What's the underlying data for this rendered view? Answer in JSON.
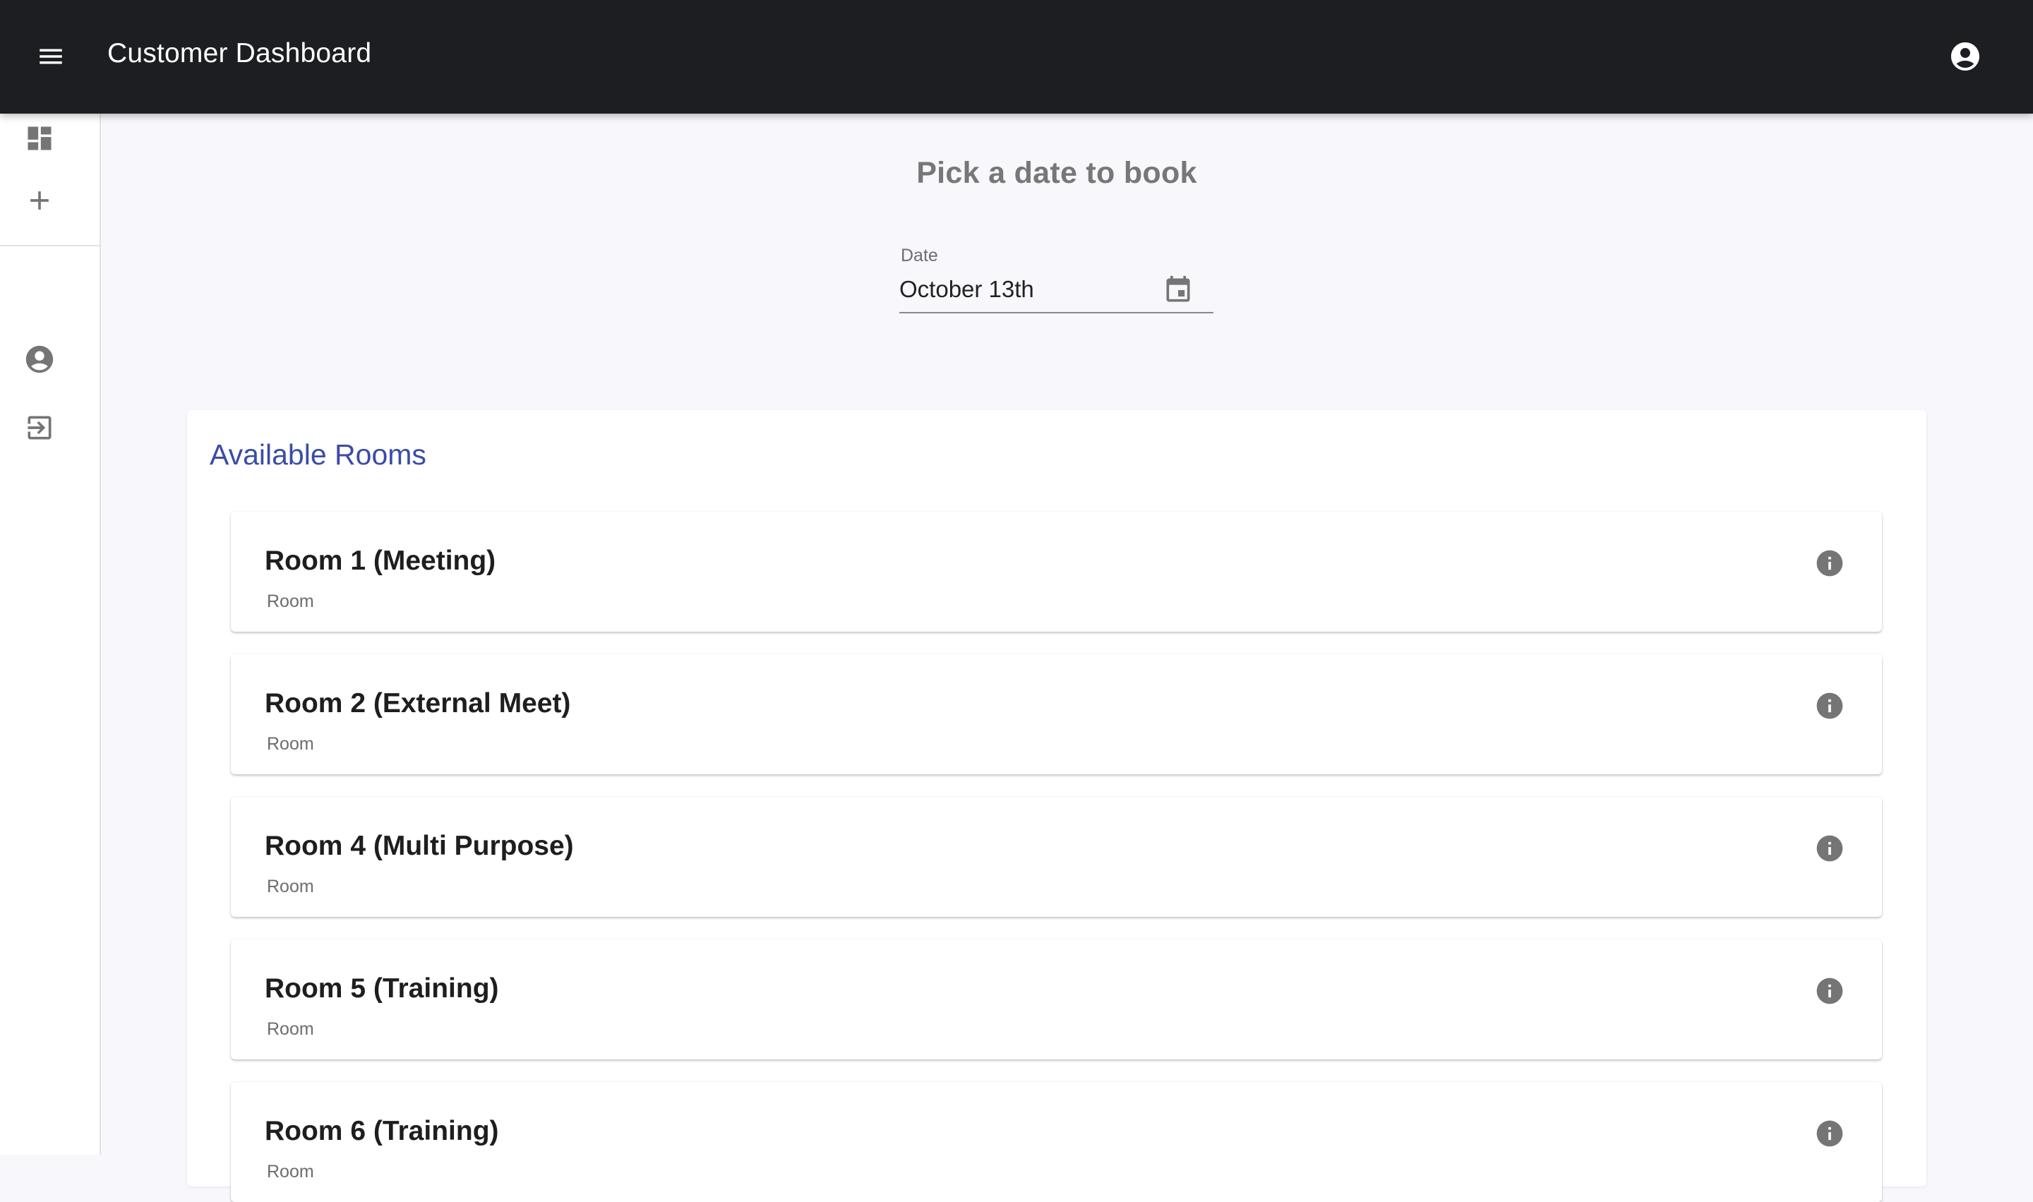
{
  "appbar": {
    "title": "Customer Dashboard",
    "menu_icon": "menu-icon",
    "account_icon": "account-circle-icon"
  },
  "sidebar": {
    "items": [
      {
        "icon": "dashboard-icon"
      },
      {
        "icon": "plus-icon"
      },
      {
        "icon": "account-circle-icon"
      },
      {
        "icon": "login-icon"
      }
    ]
  },
  "main": {
    "heading": "Pick a date to book",
    "date_field": {
      "label": "Date",
      "value": "October 13th",
      "icon": "calendar-icon"
    },
    "rooms": {
      "title": "Available Rooms",
      "items": [
        {
          "name": "Room 1 (Meeting)",
          "type": "Room"
        },
        {
          "name": "Room 2 (External Meet)",
          "type": "Room"
        },
        {
          "name": "Room 4 (Multi Purpose)",
          "type": "Room"
        },
        {
          "name": "Room 5 (Training)",
          "type": "Room"
        },
        {
          "name": "Room 6 (Training)",
          "type": "Room"
        }
      ]
    }
  },
  "colors": {
    "appbar_bg": "#1d1e22",
    "page_bg": "#f7f7fc",
    "accent": "#3b4ba8",
    "icon_gray": "#757575"
  }
}
